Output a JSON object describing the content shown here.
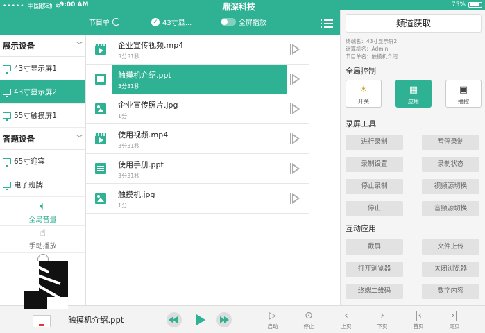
{
  "status_bar": {
    "carrier": "中国移动",
    "time": "9:00 AM",
    "app_title": "鼎深科技",
    "battery": "75%"
  },
  "toolbar": {
    "program_label": "节目单",
    "screen_label": "43寸显...",
    "fullscreen_label": "全屏播放"
  },
  "left_panel": {
    "display_section": "展示设备",
    "display_devices": [
      {
        "label": "43寸显示屏1",
        "active": false
      },
      {
        "label": "43寸显示屏2",
        "active": true
      },
      {
        "label": "55寸触摸屏1",
        "active": false
      }
    ],
    "answer_section": "答题设备",
    "answer_devices": [
      {
        "label": "65寸迎宾"
      },
      {
        "label": "电子班牌"
      }
    ],
    "global_volume_label": "全局音量",
    "manual_play_label": "手动播放"
  },
  "files": [
    {
      "name": "企业宣传视频.mp4",
      "duration": "3分31秒",
      "type": "video"
    },
    {
      "name": "触摸机介绍.ppt",
      "duration": "3分31秒",
      "type": "doc",
      "active": true
    },
    {
      "name": "企业宣传照片.jpg",
      "duration": "1分",
      "type": "img"
    },
    {
      "name": "使用视频.mp4",
      "duration": "3分31秒",
      "type": "video"
    },
    {
      "name": "使用手册.ppt",
      "duration": "3分31秒",
      "type": "doc"
    },
    {
      "name": "触摸机.jpg",
      "duration": "1分",
      "type": "img"
    }
  ],
  "right_panel": {
    "channel_button": "频道获取",
    "info": {
      "terminal": "终端名：43寸显示屏2",
      "computer": "计算机名：Admin",
      "program": "节目单名：触摸机介绍"
    },
    "global_control_title": "全局控制",
    "controls": [
      {
        "label": "开关"
      },
      {
        "label": "应用",
        "active": true
      },
      {
        "label": "播控"
      }
    ],
    "record_title": "录屏工具",
    "record_buttons": [
      "进行录制",
      "暂停录制",
      "录制设置",
      "录制状态",
      "停止录制",
      "视频源切换",
      "停止",
      "音频源切换"
    ],
    "interact_title": "互动应用",
    "interact_buttons": [
      "截屏",
      "文件上传",
      "打开浏览器",
      "关闭浏览器",
      "终端二维码",
      "数字内容"
    ]
  },
  "bottom_bar": {
    "now_playing": "触摸机介绍.ppt",
    "controls": [
      "启动",
      "停止",
      "上页",
      "下页",
      "首页",
      "尾页"
    ]
  },
  "colors": {
    "accent": "#2fb193",
    "panel_bg": "#f5f5f5",
    "button_gray": "#e2e2e2"
  }
}
